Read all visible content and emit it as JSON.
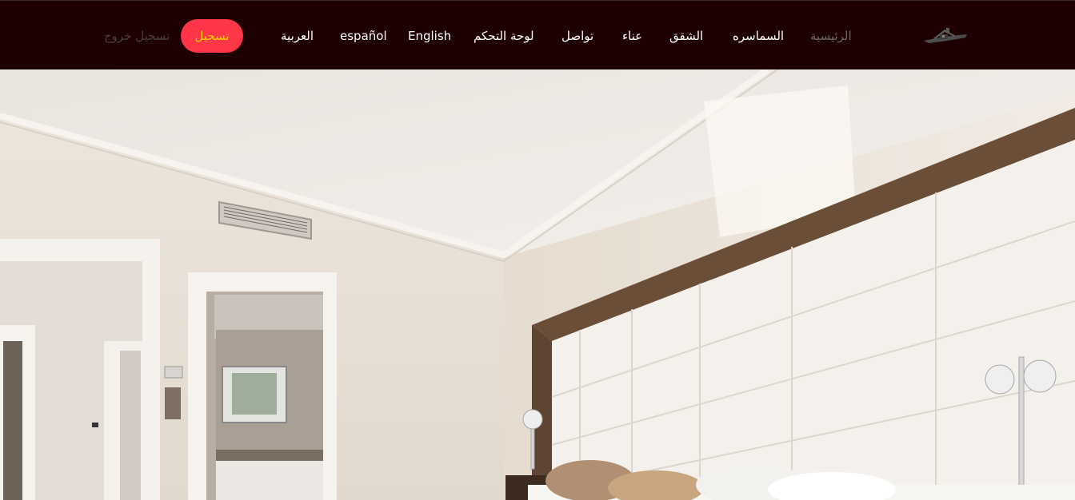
{
  "nav": {
    "logout": "تسجيل خروج",
    "register": "تسجيل",
    "arabic": "العربية",
    "spanish": "español",
    "english": "English",
    "dashboard": "لوحة التحكم",
    "contact": "تواصل",
    "building": "عناء",
    "apartments": "الشقق",
    "brokers": "السماسره",
    "home": "الرئيسية"
  },
  "logo": {
    "icon": "house-icon"
  },
  "hero": {
    "image": "bedroom-photo"
  },
  "colors": {
    "navbar": "#1e0003",
    "accent": "#ff3548",
    "register_text": "#ffd400"
  }
}
